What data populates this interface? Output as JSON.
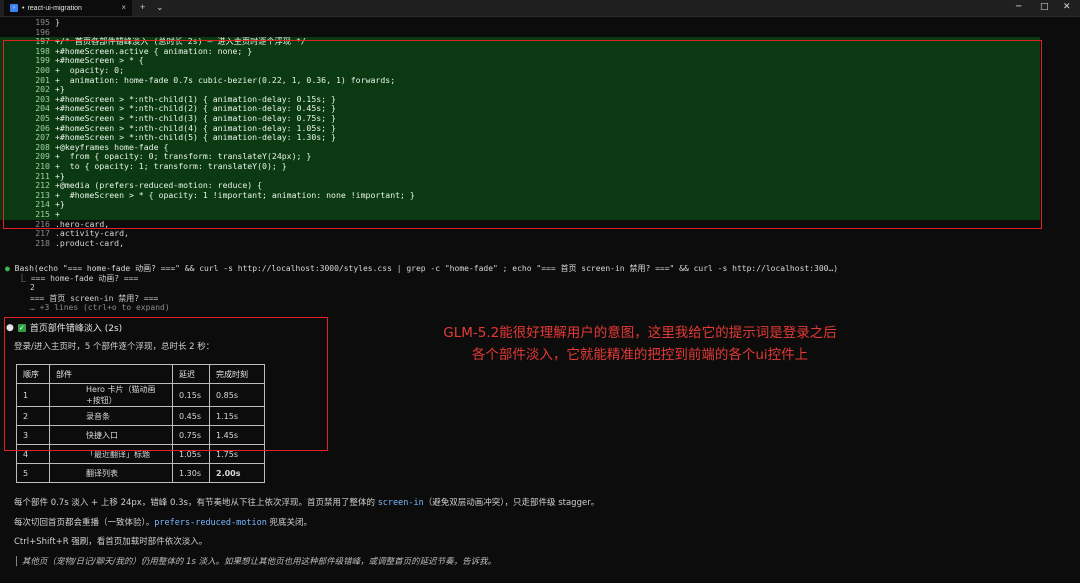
{
  "titlebar": {
    "tab_title": "react-ui-migration",
    "tab_dot": "•",
    "new_tab_symbol": "+",
    "dropdown_symbol": "⌄",
    "close_symbol": "×",
    "win_min": "─",
    "win_max": "□",
    "win_close": "✕"
  },
  "diff": {
    "lines": [
      {
        "num": "195",
        "type": "ctx",
        "text": "}"
      },
      {
        "num": "196",
        "type": "ctx",
        "text": ""
      },
      {
        "num": "197",
        "type": "add",
        "text": "+/* 首页各部件错峰淡入 (总时长 2s) — 进入主页时逐个浮现 */"
      },
      {
        "num": "198",
        "type": "add",
        "text": "+#homeScreen.active { animation: none; }"
      },
      {
        "num": "199",
        "type": "add",
        "text": "+#homeScreen > * {"
      },
      {
        "num": "200",
        "type": "add",
        "text": "+  opacity: 0;"
      },
      {
        "num": "201",
        "type": "add",
        "text": "+  animation: home-fade 0.7s cubic-bezier(0.22, 1, 0.36, 1) forwards;"
      },
      {
        "num": "202",
        "type": "add",
        "text": "+}"
      },
      {
        "num": "203",
        "type": "add",
        "text": "+#homeScreen > *:nth-child(1) { animation-delay: 0.15s; }"
      },
      {
        "num": "204",
        "type": "add",
        "text": "+#homeScreen > *:nth-child(2) { animation-delay: 0.45s; }"
      },
      {
        "num": "205",
        "type": "add",
        "text": "+#homeScreen > *:nth-child(3) { animation-delay: 0.75s; }"
      },
      {
        "num": "206",
        "type": "add",
        "text": "+#homeScreen > *:nth-child(4) { animation-delay: 1.05s; }"
      },
      {
        "num": "207",
        "type": "add",
        "text": "+#homeScreen > *:nth-child(5) { animation-delay: 1.30s; }"
      },
      {
        "num": "208",
        "type": "add",
        "text": "+@keyframes home-fade {"
      },
      {
        "num": "209",
        "type": "add",
        "text": "+  from { opacity: 0; transform: translateY(24px); }"
      },
      {
        "num": "210",
        "type": "add",
        "text": "+  to { opacity: 1; transform: translateY(0); }"
      },
      {
        "num": "211",
        "type": "add",
        "text": "+}"
      },
      {
        "num": "212",
        "type": "add",
        "text": "+@media (prefers-reduced-motion: reduce) {"
      },
      {
        "num": "213",
        "type": "add",
        "text": "+  #homeScreen > * { opacity: 1 !important; animation: none !important; }"
      },
      {
        "num": "214",
        "type": "add",
        "text": "+}"
      },
      {
        "num": "215",
        "type": "add",
        "text": "+"
      },
      {
        "num": "216",
        "type": "ctx",
        "text": ".hero-card,"
      },
      {
        "num": "217",
        "type": "ctx",
        "text": ".activity-card,"
      },
      {
        "num": "218",
        "type": "ctx",
        "text": ".product-card,"
      }
    ]
  },
  "bash": {
    "bullet": "●",
    "command": "Bash(echo \"=== home-fade 动画? ===\" && curl -s http://localhost:3000/styles.css | grep -c \"home-fade\" ; echo \"=== 首页 screen-in 禁用? ===\" && curl -s http://localhost:300…)",
    "out1": "⎿ === home-fade 动画? ===",
    "out2": "2",
    "out3": "=== 首页 screen-in 禁用? ===",
    "more": "… +3 lines (ctrl+o to expand)"
  },
  "result": {
    "bullet": "●",
    "check": "✓",
    "heading": "首页部件错峰淡入 (2s)",
    "intro": "登录/进入主页时，5 个部件逐个浮现，总时长 2 秒：",
    "table": {
      "headers": [
        "顺序",
        "部件",
        "延迟",
        "完成时刻"
      ],
      "rows": [
        [
          "1",
          "Hero 卡片（猫动画+按钮）",
          "0.15s",
          "0.85s"
        ],
        [
          "2",
          "录音条",
          "0.45s",
          "1.15s"
        ],
        [
          "3",
          "快捷入口",
          "0.75s",
          "1.45s"
        ],
        [
          "4",
          "「最近翻译」标题",
          "1.05s",
          "1.75s"
        ],
        [
          "5",
          "翻译列表",
          "1.30s",
          "2.00s"
        ]
      ]
    },
    "para1_a": "每个部件 0.7s 淡入 + 上移 24px，错峰 0.3s，有节奏地从下往上依次浮现。首页禁用了整体的 ",
    "para1_code": "screen-in",
    "para1_b": "（避免双层动画冲突），只走部件级 stagger。",
    "para2_a": "每次切回首页都会重播（一致体验）。",
    "para2_code": "prefers-reduced-motion",
    "para2_b": " 兜底关闭。",
    "para3": "Ctrl+Shift+R 强刷，看首页加载时部件依次淡入。",
    "para4": "│ 其他页（宠物/日记/聊天/我的）仍用整体的 1s 淡入。如果想让其他页也用这种部件级错峰，或调整首页的延迟节奏，告诉我。"
  },
  "annotation": {
    "text": "GLM-5.2能很好理解用户的意图，这里我给它的提示词是登录之后各个部件淡入，它就能精准的把控到前端的各个ui控件上"
  },
  "colors": {
    "annotation_red": "#e53935",
    "diff_add_bg": "#0b3a12",
    "checkbox_green": "#2ea043"
  }
}
